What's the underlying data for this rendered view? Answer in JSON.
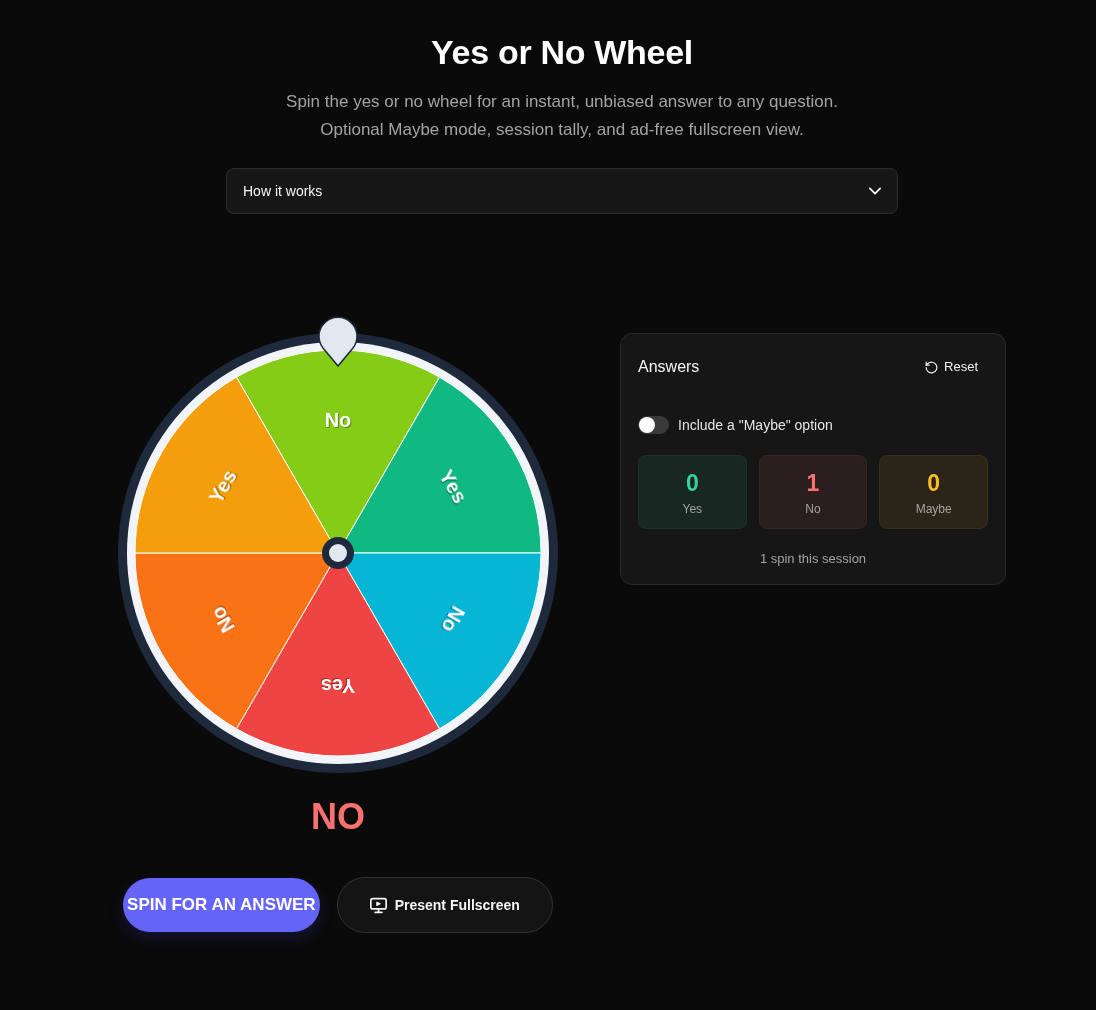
{
  "header": {
    "title": "Yes or No Wheel",
    "subtitle": [
      "Spin the yes or no wheel for an instant, unbiased answer to any question.",
      "Optional Maybe mode, session tally, and ad-free fullscreen view."
    ]
  },
  "accordion": {
    "label": "How it works",
    "expanded": false
  },
  "wheel": {
    "segments": [
      {
        "label": "No",
        "color": "#84cc16"
      },
      {
        "label": "Yes",
        "color": "#10b981"
      },
      {
        "label": "No",
        "color": "#06b6d4"
      },
      {
        "label": "Yes",
        "color": "#ef4444"
      },
      {
        "label": "No",
        "color": "#f97316"
      },
      {
        "label": "Yes",
        "color": "#f59e0b"
      }
    ]
  },
  "result": {
    "text": "NO"
  },
  "buttons": [
    {
      "kind": "primary",
      "label": "SPIN FOR AN ANSWER"
    },
    {
      "kind": "present",
      "label": "Present Fullscreen"
    }
  ],
  "tally": {
    "title": "Answers",
    "reset": {
      "label": "Reset"
    },
    "maybe_toggle": {
      "label": "Include a \"Maybe\" option",
      "on": false
    },
    "counts": [
      {
        "value": "0",
        "label": "Yes",
        "color": "#34d399"
      },
      {
        "value": "1",
        "label": "No",
        "color": "#f87171"
      },
      {
        "value": "0",
        "label": "Maybe",
        "color": "#fbbf24"
      }
    ],
    "summary": "1 spin this session"
  }
}
